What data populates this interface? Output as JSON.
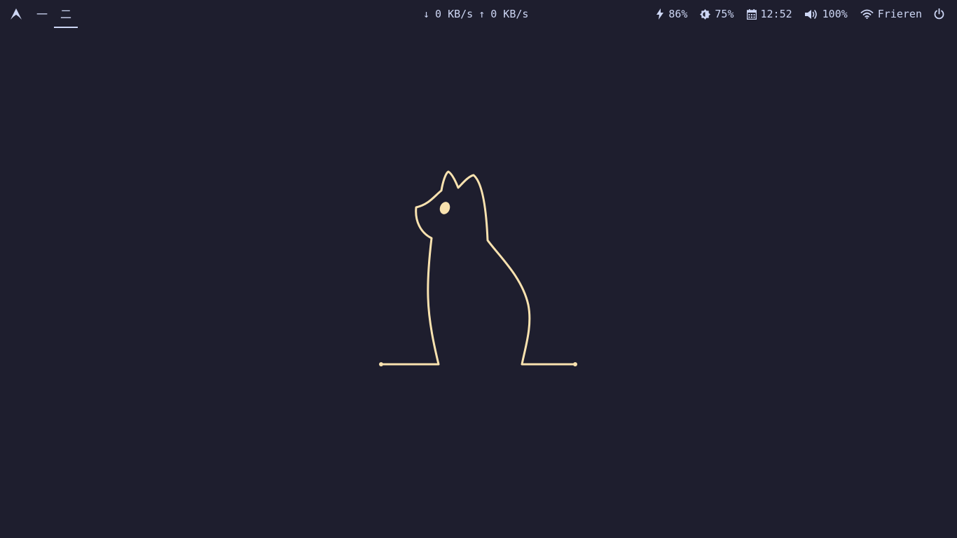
{
  "bar": {
    "workspaces": [
      {
        "label": "一",
        "active": false
      },
      {
        "label": "二",
        "active": true
      }
    ],
    "network": {
      "down_arrow": "↓",
      "down": "0 KB/s",
      "up_arrow": "↑",
      "up": "0 KB/s"
    },
    "battery": {
      "value": "86%",
      "icon": "bolt-icon"
    },
    "brightness": {
      "value": "75%",
      "icon": "brightness-icon"
    },
    "clock": {
      "value": "12:52",
      "icon": "calendar-icon"
    },
    "volume": {
      "value": "100%",
      "icon": "speaker-icon"
    },
    "wifi": {
      "value": "Frieren",
      "icon": "wifi-icon"
    },
    "power": {
      "icon": "power-icon"
    }
  },
  "colors": {
    "background": "#1e1e2e",
    "foreground": "#cdd6f4",
    "accent": "#f9e2af"
  }
}
